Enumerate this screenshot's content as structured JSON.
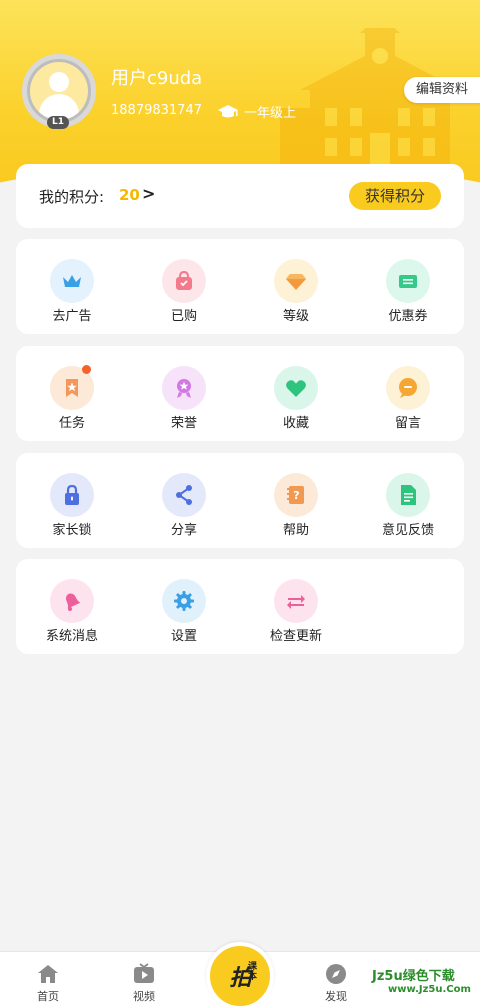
{
  "profile": {
    "username": "用户c9uda",
    "phone": "18879831747",
    "grade": "一年级上",
    "level": "L1",
    "edit_label": "编辑资料"
  },
  "points": {
    "label": "我的积分:",
    "value": "20",
    "arrow": ">",
    "earn_label": "获得积分"
  },
  "groups": [
    {
      "items": [
        {
          "label": "去广告",
          "icon": "crown-icon"
        },
        {
          "label": "已购",
          "icon": "shopping-bag-icon"
        },
        {
          "label": "等级",
          "icon": "diamond-icon"
        },
        {
          "label": "优惠券",
          "icon": "coupon-icon"
        }
      ]
    },
    {
      "items": [
        {
          "label": "任务",
          "icon": "task-star-icon"
        },
        {
          "label": "荣誉",
          "icon": "medal-icon"
        },
        {
          "label": "收藏",
          "icon": "heart-icon"
        },
        {
          "label": "留言",
          "icon": "message-icon"
        }
      ]
    },
    {
      "items": [
        {
          "label": "家长锁",
          "icon": "lock-icon"
        },
        {
          "label": "分享",
          "icon": "share-icon"
        },
        {
          "label": "帮助",
          "icon": "help-book-icon"
        },
        {
          "label": "意见反馈",
          "icon": "feedback-doc-icon"
        }
      ]
    },
    {
      "items": [
        {
          "label": "系统消息",
          "icon": "bell-icon"
        },
        {
          "label": "设置",
          "icon": "gear-icon"
        },
        {
          "label": "检查更新",
          "icon": "refresh-arrows-icon"
        }
      ]
    }
  ],
  "tabbar": {
    "home": "首页",
    "video": "视频",
    "center_main": "拍",
    "center_sub": "课本",
    "discover": "发现"
  },
  "watermark": {
    "main": "Jz5u绿色下载",
    "sub": "www.Jz5u.Com"
  },
  "colors": {
    "accent": "#f9cb1e",
    "points_value": "#f6b800",
    "badge_dot": "#f4622b"
  }
}
